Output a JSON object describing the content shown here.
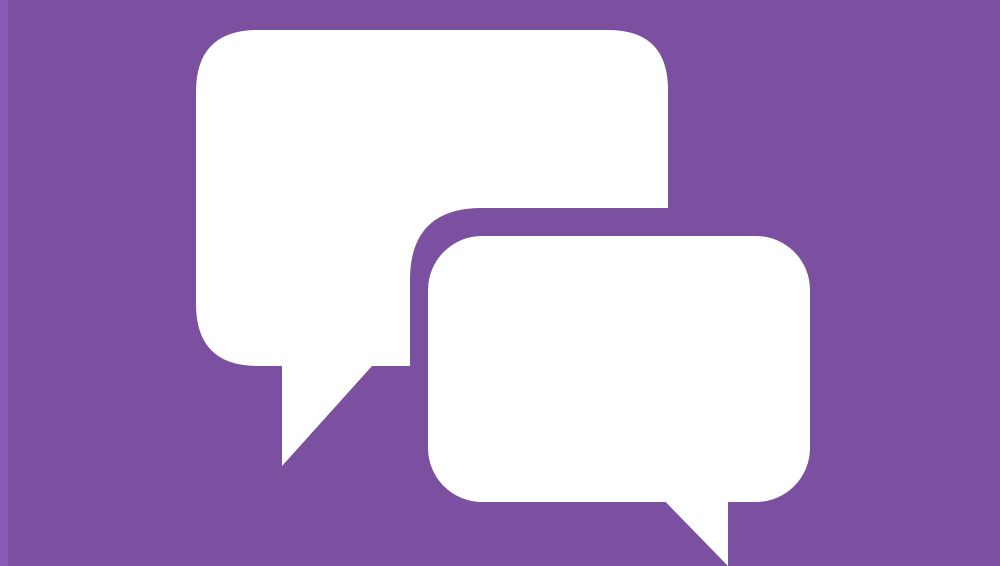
{
  "tile": {
    "background_color": "#7b50a0",
    "edge_color": "#8a5bb4",
    "icon_color": "#ffffff",
    "icon": "chat-bubbles-icon"
  }
}
